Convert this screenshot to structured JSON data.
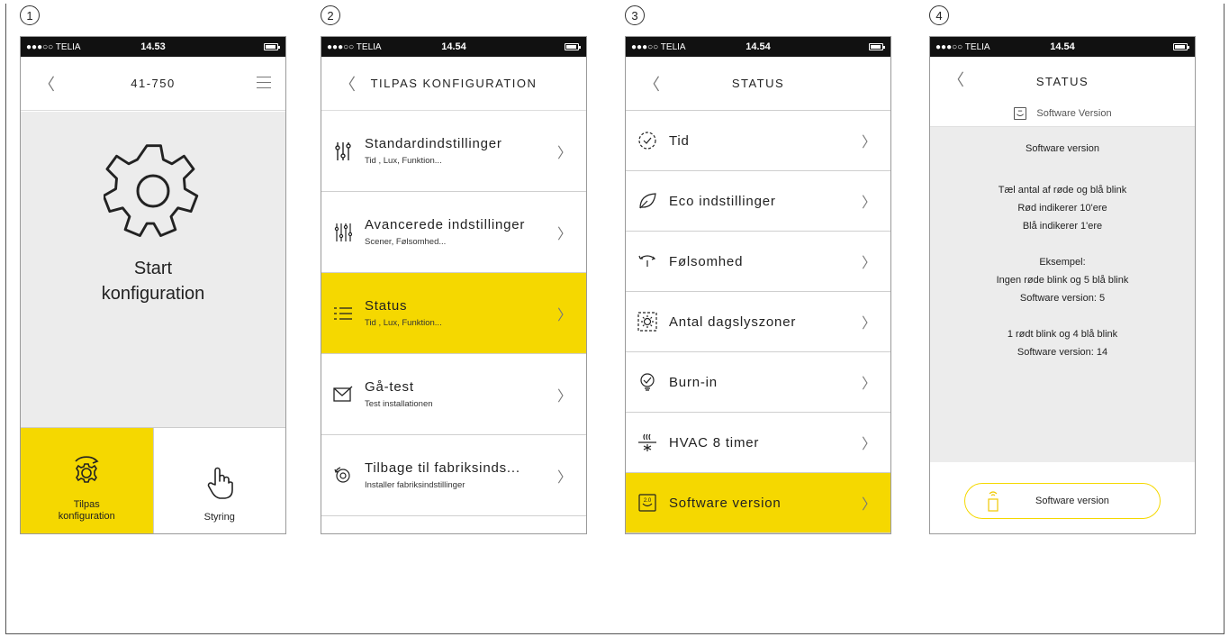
{
  "steps": [
    "1",
    "2",
    "3",
    "4"
  ],
  "statusbar": {
    "carrier": "●●●○○ TELIA",
    "times": [
      "14.53",
      "14.54",
      "14.54",
      "14.54"
    ]
  },
  "screen1": {
    "title": "41-750",
    "main_label_line1": "Start",
    "main_label_line2": "konfiguration",
    "buttons": [
      {
        "label_line1": "Tilpas",
        "label_line2": "konfiguration"
      },
      {
        "label_line1": "Styring",
        "label_line2": ""
      }
    ]
  },
  "screen2": {
    "title": "TILPAS KONFIGURATION",
    "items": [
      {
        "title": "Standardindstillinger",
        "subtitle": "Tid , Lux, Funktion..."
      },
      {
        "title": "Avancerede indstillinger",
        "subtitle": "Scener, Følsomhed..."
      },
      {
        "title": "Status",
        "subtitle": "Tid , Lux, Funktion..."
      },
      {
        "title": "Gå-test",
        "subtitle": "Test installationen"
      },
      {
        "title": "Tilbage til fabriksinds...",
        "subtitle": "Installer fabriksindstillinger"
      }
    ]
  },
  "screen3": {
    "title": "STATUS",
    "items": [
      {
        "title": "Tid"
      },
      {
        "title": "Eco indstillinger"
      },
      {
        "title": "Følsomhed"
      },
      {
        "title": "Antal dagslyszoner"
      },
      {
        "title": "Burn-in"
      },
      {
        "title": "HVAC 8 timer"
      },
      {
        "title": "Software version"
      }
    ]
  },
  "screen4": {
    "title": "STATUS",
    "subtitle": "Software Version",
    "lines": [
      "Software version",
      "",
      "Tæl antal af røde og blå blink",
      "Rød indikerer 10'ere",
      "Blå indikerer 1'ere",
      "",
      "Eksempel:",
      "Ingen røde blink og 5 blå blink",
      "Software version: 5",
      "",
      "1 rødt blink og 4 blå blink",
      "Software version: 14"
    ],
    "button_label": "Software version"
  },
  "colors": {
    "accent": "#f5d800",
    "panel": "#ececec"
  }
}
